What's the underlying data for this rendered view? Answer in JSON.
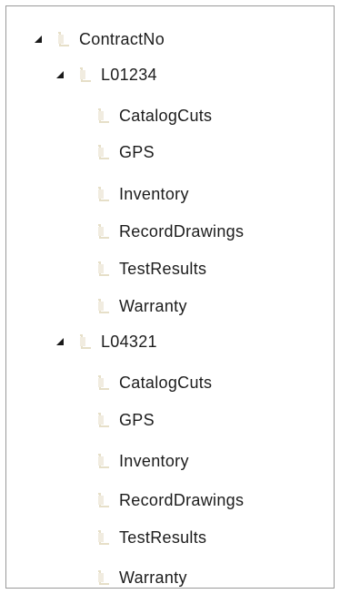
{
  "tree": {
    "root": {
      "label": "ContractNo",
      "expanded": true,
      "children": [
        {
          "label": "L01234",
          "expanded": true,
          "children": [
            {
              "label": "CatalogCuts"
            },
            {
              "label": "GPS"
            },
            {
              "label": "Inventory"
            },
            {
              "label": "RecordDrawings"
            },
            {
              "label": "TestResults"
            },
            {
              "label": "Warranty"
            }
          ]
        },
        {
          "label": "L04321",
          "expanded": true,
          "children": [
            {
              "label": "CatalogCuts"
            },
            {
              "label": "GPS"
            },
            {
              "label": "Inventory"
            },
            {
              "label": "RecordDrawings"
            },
            {
              "label": "TestResults"
            },
            {
              "label": "Warranty"
            }
          ]
        }
      ]
    }
  },
  "icons": {
    "expander": "expanded-triangle-icon",
    "folder": "folder-icon"
  },
  "colors": {
    "border": "#9a9a9a",
    "text": "#1c1c1c",
    "expander": "#1a1a1a",
    "folder": "#e6dfc8"
  }
}
